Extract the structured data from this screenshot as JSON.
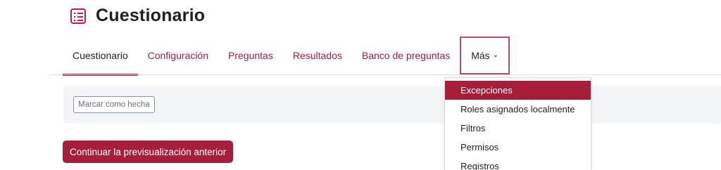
{
  "header": {
    "title": "Cuestionario",
    "icon": "quiz-icon",
    "icon_color": "#c2185b"
  },
  "nav": {
    "tabs": [
      {
        "label": "Cuestionario",
        "active": true
      },
      {
        "label": "Configuración"
      },
      {
        "label": "Preguntas"
      },
      {
        "label": "Resultados"
      },
      {
        "label": "Banco de preguntas"
      }
    ],
    "more_label": "Más"
  },
  "completion": {
    "mark_done_label": "Marcar como hecha"
  },
  "preview": {
    "continue_label": "Continuar la previsualización anterior"
  },
  "more_menu": {
    "items": [
      {
        "label": "Excepciones",
        "active": true
      },
      {
        "label": "Roles asignados localmente"
      },
      {
        "label": "Filtros"
      },
      {
        "label": "Permisos"
      },
      {
        "label": "Registros"
      }
    ]
  },
  "colors": {
    "accent": "#a71e3b",
    "bar_bg": "#f3f6f8"
  }
}
